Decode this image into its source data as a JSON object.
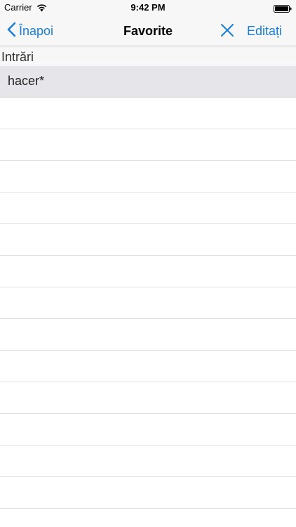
{
  "status_bar": {
    "carrier": "Carrier",
    "time": "9:42 PM",
    "wifi_icon": "wifi-icon",
    "battery_icon": "battery-icon"
  },
  "nav": {
    "back_label": "Înapoi",
    "title": "Favorite",
    "close_icon": "close-icon",
    "edit_label": "Editați"
  },
  "section": {
    "header": "Intrări"
  },
  "entries": [
    {
      "label": "hacer*",
      "selected": true
    }
  ],
  "colors": {
    "accent": "#1a7ed6",
    "bar_background": "#f7f7f7",
    "selected_row": "#e5e5ea"
  }
}
